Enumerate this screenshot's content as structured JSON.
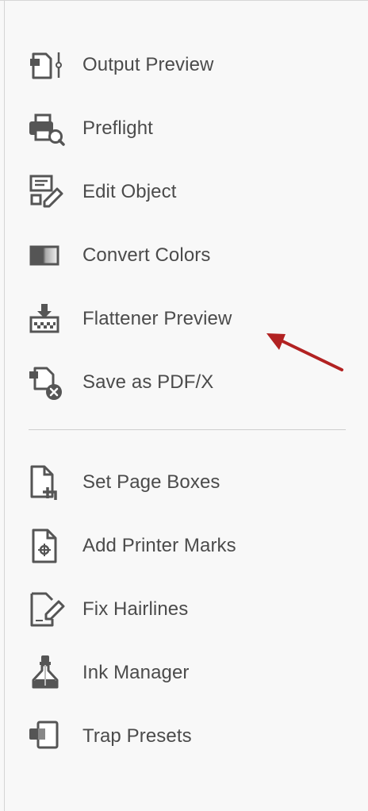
{
  "colors": {
    "panel_bg": "#f8f8f8",
    "label": "#4b4b4b",
    "icon": "#555555",
    "arrow": "#b22222"
  },
  "tools_group1": [
    {
      "label": "Output Preview",
      "icon": "output-preview-icon"
    },
    {
      "label": "Preflight",
      "icon": "preflight-icon"
    },
    {
      "label": "Edit Object",
      "icon": "edit-object-icon"
    },
    {
      "label": "Convert Colors",
      "icon": "convert-colors-icon"
    },
    {
      "label": "Flattener Preview",
      "icon": "flattener-preview-icon"
    },
    {
      "label": "Save as PDF/X",
      "icon": "save-as-pdfx-icon"
    }
  ],
  "tools_group2": [
    {
      "label": "Set Page Boxes",
      "icon": "set-page-boxes-icon"
    },
    {
      "label": "Add Printer Marks",
      "icon": "add-printer-marks-icon"
    },
    {
      "label": "Fix Hairlines",
      "icon": "fix-hairlines-icon"
    },
    {
      "label": "Ink Manager",
      "icon": "ink-manager-icon"
    },
    {
      "label": "Trap Presets",
      "icon": "trap-presets-icon"
    }
  ],
  "annotation": {
    "icon": "red-arrow-icon"
  }
}
